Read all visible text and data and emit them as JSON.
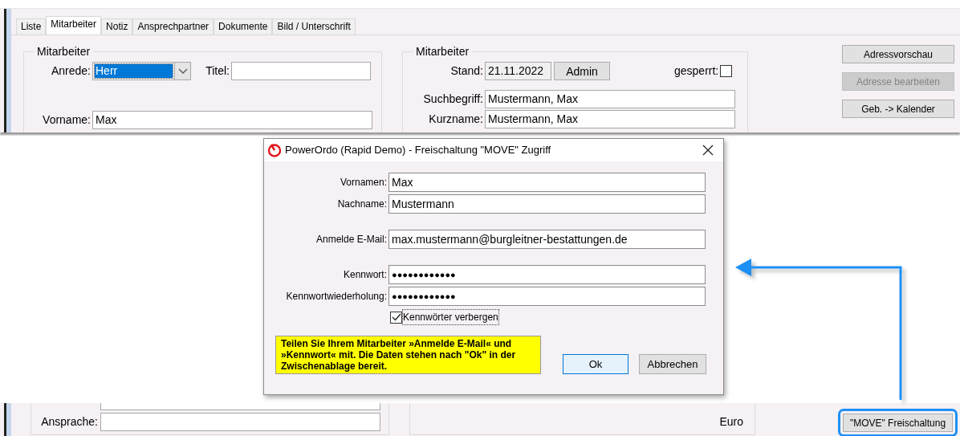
{
  "tabs": [
    {
      "label": "Liste",
      "selected": false
    },
    {
      "label": "Mitarbeiter",
      "selected": true
    },
    {
      "label": "Notiz",
      "selected": false
    },
    {
      "label": "Ansprechpartner",
      "selected": false
    },
    {
      "label": "Dokumente",
      "selected": false
    },
    {
      "label": "Bild / Unterschrift",
      "selected": false
    }
  ],
  "person_group": {
    "title": "Mitarbeiter",
    "anrede_label": "Anrede:",
    "anrede_value": "Herr",
    "titel_label": "Titel:",
    "vorname_label": "Vorname:",
    "vorname_value": "Max"
  },
  "status_group": {
    "title": "Mitarbeiter",
    "stand_label": "Stand:",
    "stand_date": "21.11.2022",
    "stand_user": "Admin",
    "gesperrt_label": "gesperrt:",
    "gesperrt_checked": false,
    "suchbegriff_label": "Suchbegriff:",
    "suchbegriff_value": "Mustermann, Max",
    "kurzname_label": "Kurzname:",
    "kurzname_value": "Mustermann, Max"
  },
  "side_buttons": [
    {
      "label": "Adressvorschau",
      "disabled": false
    },
    {
      "label": "Adresse bearbeiten",
      "disabled": true
    },
    {
      "label": "Geb. -> Kalender",
      "disabled": false
    }
  ],
  "dialog": {
    "title": "PowerOrdo (Rapid Demo) - Freischaltung \"MOVE\" Zugriff",
    "fields": [
      {
        "label": "Vornamen:",
        "value": "Max"
      },
      {
        "label": "Nachname:",
        "value": "Mustermann"
      },
      {
        "label": "Anmelde E-Mail:",
        "value": "max.mustermann@burgleitner-bestattungen.de"
      },
      {
        "label": "Kennwort:",
        "value": "●●●●●●●●●●●●"
      },
      {
        "label": "Kennwortwiederholung:",
        "value": "●●●●●●●●●●●●"
      }
    ],
    "hide_passwords": {
      "label": "Kennwörter verbergen",
      "checked": true
    },
    "note": "Teilen Sie Ihrem Mitarbeiter »Anmelde E-Mail« und »Kennwort« mit. Die Daten stehen nach \"Ok\" in der Zwischenablage bereit.",
    "ok_button": "Ok",
    "cancel_button": "Abbrechen"
  },
  "bottom": {
    "ansprache_label": "Ansprache:",
    "currency": "Euro",
    "move_button": {
      "label": "\"MOVE\" Freischaltung",
      "highlighted": true
    }
  }
}
